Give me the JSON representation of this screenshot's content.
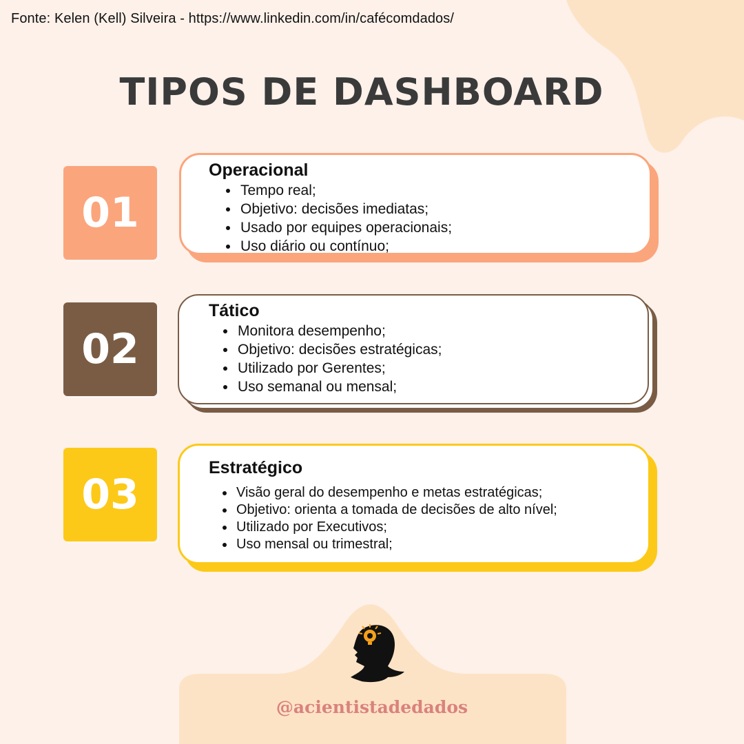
{
  "source": "Fonte: Kelen (Kell) Silveira - https://www.linkedin.com/in/cafécomdados/",
  "title": "TIPOS DE DASHBOARD",
  "colors": {
    "background": "#fdf1ea",
    "blob": "#fde3c6",
    "operacional": "#fba57c",
    "tatico": "#7a5c45",
    "estrategico": "#fdc918",
    "handle": "#d9827e"
  },
  "items": [
    {
      "number": "01",
      "title": "Operacional",
      "bullets": [
        "Tempo real;",
        "Objetivo: decisões imediatas;",
        "Usado por equipes operacionais;",
        "Uso diário ou contínuo;"
      ]
    },
    {
      "number": "02",
      "title": "Tático",
      "bullets": [
        "Monitora desempenho;",
        "Objetivo: decisões estratégicas;",
        "Utilizado por Gerentes;",
        "Uso semanal ou mensal;"
      ]
    },
    {
      "number": "03",
      "title": "Estratégico",
      "bullets": [
        "Visão geral do desempenho e metas estratégicas;",
        "Objetivo: orienta a tomada de decisões de alto nível;",
        "Utilizado por Executivos;",
        "Uso mensal ou trimestral;"
      ]
    }
  ],
  "footer": {
    "icon": "woman-silhouette-lightbulb-icon",
    "handle": "@acientistadedados"
  }
}
